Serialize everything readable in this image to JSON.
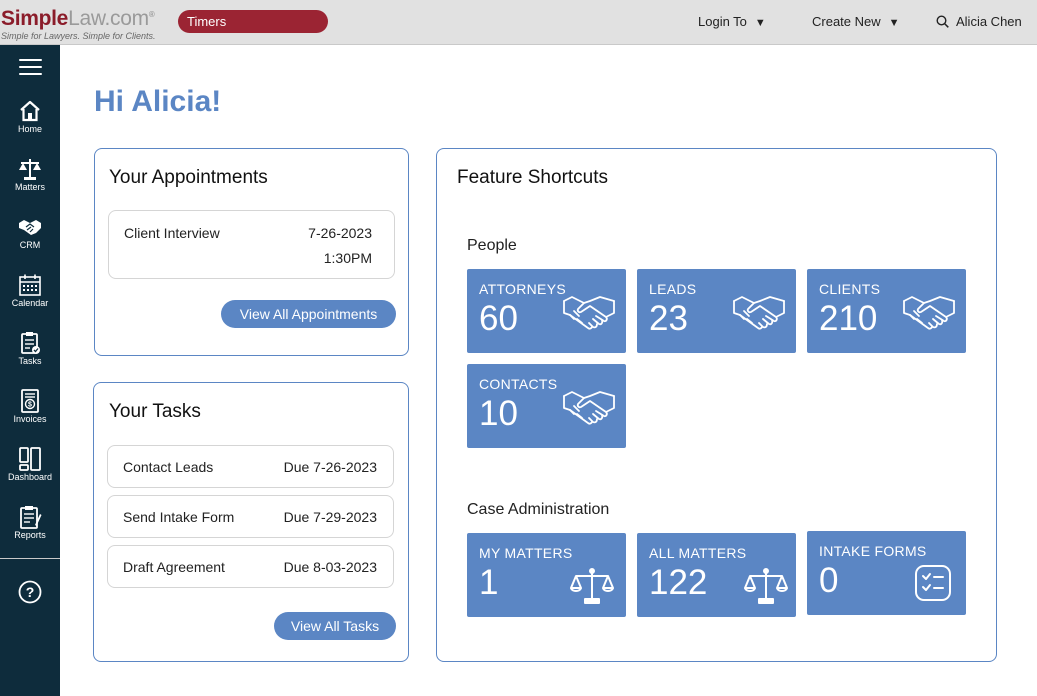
{
  "header": {
    "logo_primary": "Simple",
    "logo_secondary": "Law.com",
    "logo_mark": "®",
    "logo_tagline": "Simple for Lawyers. Simple for Clients.",
    "timers_label": "Timers",
    "login_to_label": "Login To",
    "create_new_label": "Create New",
    "user_name": "Alicia Chen"
  },
  "sidebar": {
    "items": [
      {
        "label": "Home",
        "icon": "home-icon"
      },
      {
        "label": "Matters",
        "icon": "scales-icon"
      },
      {
        "label": "CRM",
        "icon": "handshake-icon"
      },
      {
        "label": "Calendar",
        "icon": "calendar-icon"
      },
      {
        "label": "Tasks",
        "icon": "tasks-icon"
      },
      {
        "label": "Invoices",
        "icon": "invoice-icon"
      },
      {
        "label": "Dashboard",
        "icon": "dashboard-icon"
      },
      {
        "label": "Reports",
        "icon": "reports-icon"
      }
    ],
    "help_icon": "help-icon"
  },
  "greeting": "Hi Alicia!",
  "appointments": {
    "title": "Your Appointments",
    "items": [
      {
        "name": "Client Interview",
        "date": "7-26-2023",
        "time": "1:30PM"
      }
    ],
    "view_all_label": "View All Appointments"
  },
  "tasks": {
    "title": "Your Tasks",
    "items": [
      {
        "name": "Contact Leads",
        "due": "Due 7-26-2023"
      },
      {
        "name": "Send Intake Form",
        "due": "Due 7-29-2023"
      },
      {
        "name": "Draft Agreement",
        "due": "Due 8-03-2023"
      }
    ],
    "view_all_label": "View All Tasks"
  },
  "shortcuts": {
    "title": "Feature Shortcuts",
    "people_label": "People",
    "people": [
      {
        "label": "ATTORNEYS",
        "count": "60",
        "icon": "handshake-icon"
      },
      {
        "label": "LEADS",
        "count": "23",
        "icon": "handshake-icon"
      },
      {
        "label": "CLIENTS",
        "count": "210",
        "icon": "handshake-icon"
      },
      {
        "label": "CONTACTS",
        "count": "10",
        "icon": "handshake-icon"
      }
    ],
    "case_label": "Case Administration",
    "case": [
      {
        "label": "MY MATTERS",
        "count": "1",
        "icon": "scales-icon"
      },
      {
        "label": "ALL MATTERS",
        "count": "122",
        "icon": "scales-icon"
      },
      {
        "label": "INTAKE FORMS",
        "count": "0",
        "icon": "checklist-icon"
      }
    ]
  },
  "colors": {
    "brand_red": "#9b2433",
    "accent_blue": "#5b86c4",
    "sidebar_bg": "#0e2c3c",
    "topbar_bg": "#e1e1e1"
  }
}
